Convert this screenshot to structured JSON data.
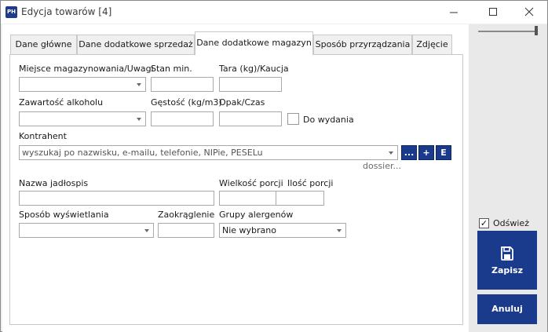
{
  "window": {
    "app_icon_text": "PH",
    "title": "Edycja towarów [4]"
  },
  "tabs": [
    {
      "label": "Dane główne",
      "active": false
    },
    {
      "label": "Dane dodatkowe sprzedaż",
      "active": false
    },
    {
      "label": "Dane dodatkowe magazyn",
      "active": true
    },
    {
      "label": "Sposób przyrządzania",
      "active": false
    },
    {
      "label": "Zdjęcie",
      "active": false
    }
  ],
  "form": {
    "storage_label": "Miejsce magazynowania/Uwagi",
    "storage_value": "",
    "stock_min_label": "Stan min.",
    "stock_min_value": "",
    "tare_label": "Tara (kg)/Kaucja",
    "tare_value": "",
    "alcohol_label": "Zawartość alkoholu",
    "alcohol_value": "",
    "density_label": "Gęstość (kg/m3)",
    "density_value": "",
    "package_label": "Opak/Czas",
    "package_value": "",
    "to_issue_label": "Do wydania",
    "to_issue_checked": false,
    "contractor_label": "Kontrahent",
    "contractor_placeholder": "wyszukaj po nazwisku, e-mailu, telefonie, NIPie, PESELu",
    "contractor_btn_more": "...",
    "contractor_btn_add": "+",
    "contractor_btn_edit": "E",
    "dossier_link": "dossier...",
    "menu_name_label": "Nazwa jadłospis",
    "menu_name_value": "",
    "portion_size_label": "Wielkość porcji",
    "portion_size_value": "",
    "portion_count_label": "Ilość porcji",
    "portion_count_value": "",
    "display_mode_label": "Sposób wyświetlania",
    "display_mode_value": "",
    "rounding_label": "Zaokrąglenie",
    "rounding_value": "",
    "allergen_label": "Grupy alergenów",
    "allergen_value": "Nie wybrano"
  },
  "side": {
    "refresh_label": "Odśwież",
    "refresh_checked": true,
    "save_label": "Zapisz",
    "cancel_label": "Anuluj"
  },
  "colors": {
    "accent": "#1a3a8c"
  }
}
